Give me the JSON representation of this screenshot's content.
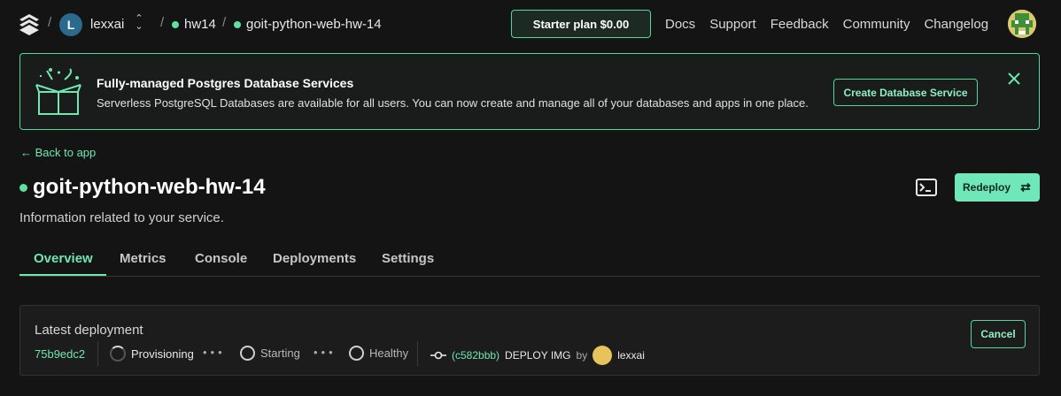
{
  "nav": {
    "team_initial": "L",
    "team_name": "lexxai",
    "project": "hw14",
    "service": "goit-python-web-hw-14",
    "plan_label": "Starter plan $0.00",
    "links": [
      "Docs",
      "Support",
      "Feedback",
      "Community",
      "Changelog"
    ]
  },
  "banner": {
    "title": "Fully-managed Postgres Database Services",
    "description": "Serverless PostgreSQL Databases are available for all users. You can now create and manage all of your databases and apps in one place.",
    "cta": "Create Database Service"
  },
  "back_link": "← Back to app",
  "service": {
    "name": "goit-python-web-hw-14",
    "subtitle": "Information related to your service.",
    "redeploy_label": "Redeploy"
  },
  "tabs": [
    "Overview",
    "Metrics",
    "Console",
    "Deployments",
    "Settings"
  ],
  "deployment": {
    "title": "Latest deployment",
    "id": "75b9edc2",
    "stages": [
      "Provisioning",
      "Starting",
      "Healthy"
    ],
    "commit_hash": "(c582bbb)",
    "commit_message": "DEPLOY IMG",
    "by_label": "by",
    "author": "lexxai",
    "cancel_label": "Cancel"
  },
  "colors": {
    "accent": "#6fe7b0",
    "background": "#141414",
    "status_dot": "#5ee0a0"
  }
}
